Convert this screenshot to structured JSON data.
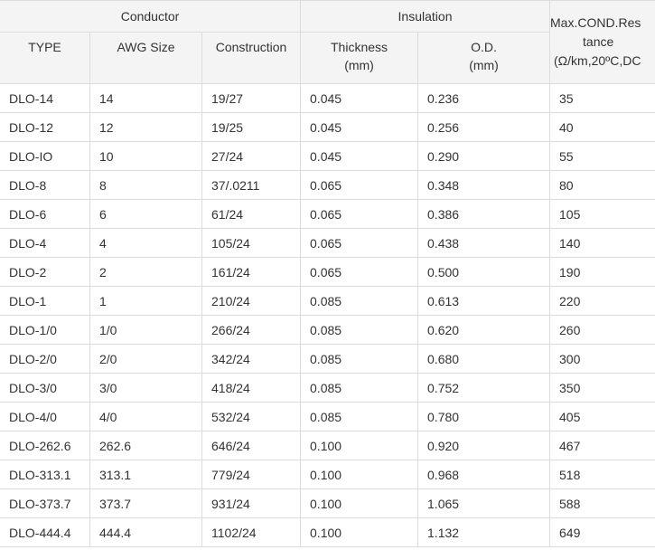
{
  "header": {
    "conductor": "Conductor",
    "insulation": "Insulation",
    "resistance_line1": "Max.COND.Res",
    "resistance_line2": "tance",
    "resistance_line3": "(Ω/km,20ºC,DC",
    "type": "TYPE",
    "awg_size": "AWG Size",
    "construction": "Construction",
    "thickness": "Thickness",
    "thickness_unit": "(mm)",
    "od": "O.D.",
    "od_unit": "(mm)"
  },
  "rows": [
    [
      "DLO-14",
      "14",
      "19/27",
      "0.045",
      "0.236",
      "35"
    ],
    [
      "DLO-12",
      "12",
      "19/25",
      "0.045",
      "0.256",
      "40"
    ],
    [
      "DLO-IO",
      "10",
      "27/24",
      "0.045",
      "0.290",
      "55"
    ],
    [
      "DLO-8",
      "8",
      "37/.0211",
      "0.065",
      "0.348",
      "80"
    ],
    [
      "DLO-6",
      "6",
      "61/24",
      "0.065",
      "0.386",
      "105"
    ],
    [
      "DLO-4",
      "4",
      "105/24",
      "0.065",
      "0.438",
      "140"
    ],
    [
      "DLO-2",
      "2",
      "161/24",
      "0.065",
      "0.500",
      "190"
    ],
    [
      "DLO-1",
      "1",
      "210/24",
      "0.085",
      "0.613",
      "220"
    ],
    [
      "DLO-1/0",
      "1/0",
      "266/24",
      "0.085",
      "0.620",
      "260"
    ],
    [
      "DLO-2/0",
      "2/0",
      "342/24",
      "0.085",
      "0.680",
      "300"
    ],
    [
      "DLO-3/0",
      "3/0",
      "418/24",
      "0.085",
      "0.752",
      "350"
    ],
    [
      "DLO-4/0",
      "4/0",
      "532/24",
      "0.085",
      "0.780",
      "405"
    ],
    [
      "DLO-262.6",
      "262.6",
      "646/24",
      "0.100",
      "0.920",
      "467"
    ],
    [
      "DLO-313.1",
      "313.1",
      "779/24",
      "0.100",
      "0.968",
      "518"
    ],
    [
      "DLO-373.7",
      "373.7",
      "931/24",
      "0.100",
      "1.065",
      "588"
    ],
    [
      "DLO-444.4",
      "444.4",
      "1102/24",
      "0.100",
      "1.132",
      "649"
    ]
  ]
}
